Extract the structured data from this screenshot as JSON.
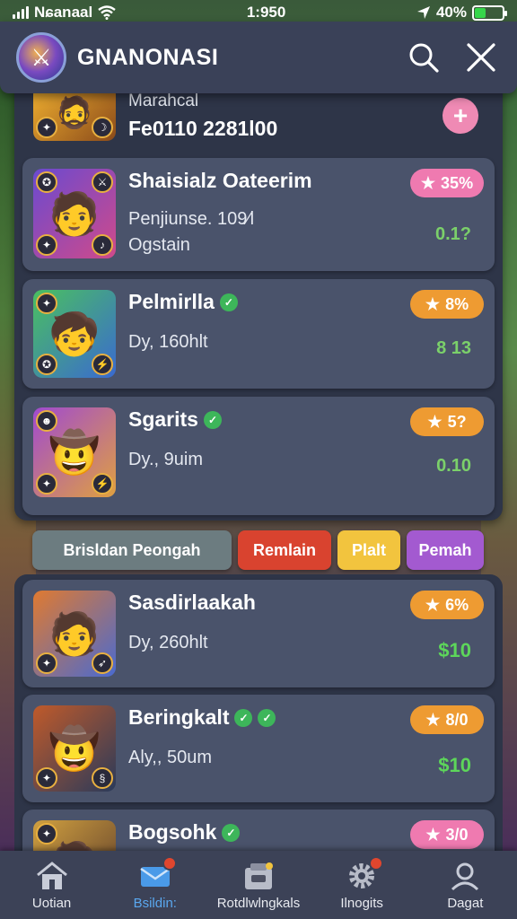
{
  "status": {
    "carrier": "Nɕanaal",
    "time": "1:950",
    "battery": "40%",
    "battery_level": 0.4
  },
  "header": {
    "title": "GNANONASI"
  },
  "top_card": {
    "line1": "Marahcal",
    "line2": "Fe0110 2281l00"
  },
  "cards": [
    {
      "name": "Shaisialz Oateerim",
      "line1": "Penjiunse. 109∕l",
      "line2": "Ogstain",
      "badge": "35%",
      "price": "0.1?",
      "badge_color": "pink"
    },
    {
      "name": "Pelmirlla",
      "line1": "Dy, 160hlt",
      "badge": "8%",
      "price": "8 13",
      "badge_color": "orange"
    },
    {
      "name": "Sgarits",
      "line1": "Dy., 9uim",
      "badge": "5?",
      "price": "0.10",
      "badge_color": "orange"
    }
  ],
  "filters": [
    "Brisldan Peongah",
    "Remlain",
    "Plalt",
    "Pemah"
  ],
  "cards2": [
    {
      "name": "Sasdirlaakah",
      "line1": "Dy, 260hlt",
      "badge": "6%",
      "price": "$10",
      "badge_color": "orange"
    },
    {
      "name": "Beringkalt",
      "line1": "Aly,, 50um",
      "badge": "8/0",
      "price": "$10",
      "badge_color": "orange"
    },
    {
      "name": "Bogsohk",
      "badge": "3/0",
      "badge_color": "pink"
    }
  ],
  "tabs": [
    {
      "label": "Uotian",
      "icon": "home-icon"
    },
    {
      "label": "Bsildin:",
      "icon": "mail-icon"
    },
    {
      "label": "Rotdlwlngkals",
      "icon": "store-icon"
    },
    {
      "label": "Ilnogits",
      "icon": "gear-icon"
    },
    {
      "label": "Dagat",
      "icon": "user-icon"
    }
  ],
  "colors": {
    "accent": "#5aa8f0",
    "header": "#3a4158",
    "card": "#4a536b",
    "price": "#7bd06a"
  }
}
